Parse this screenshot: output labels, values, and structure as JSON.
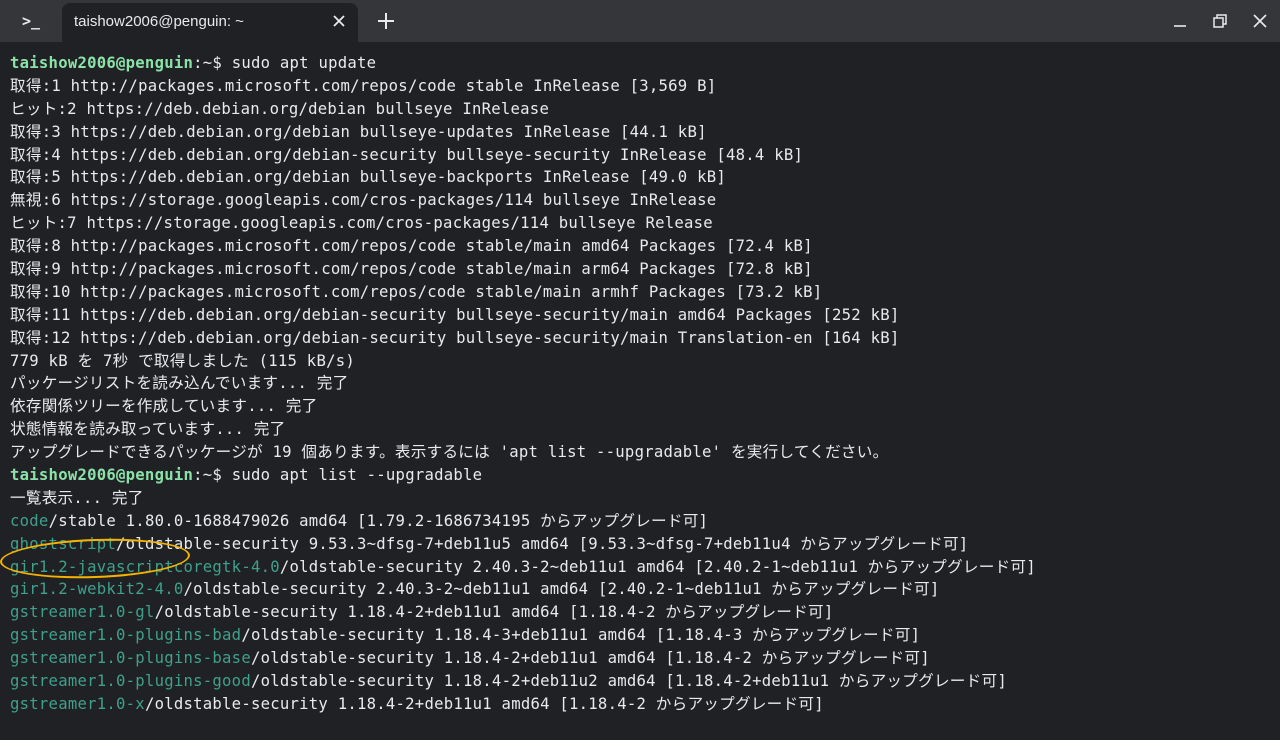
{
  "window": {
    "app_icon_label": ">_",
    "tab_title": "taishow2006@penguin: ~",
    "icons": {
      "app": "terminal-prompt-icon",
      "tab_close": "close-icon",
      "new_tab": "plus-icon",
      "minimize": "minimize-icon",
      "maximize": "maximize-icon",
      "close": "close-icon"
    }
  },
  "colors": {
    "background": "#202124",
    "titlebar": "#35363a",
    "prompt": "#8ae2a8",
    "package_name": "#3fa08b",
    "annotation_circle": "#f5b300"
  },
  "terminal": {
    "prompt_user": "taishow2006@penguin",
    "prompt_path": ":~$ ",
    "cmd1": "sudo apt update",
    "cmd2": "sudo apt list --upgradable",
    "update_output": [
      "取得:1 http://packages.microsoft.com/repos/code stable InRelease [3,569 B]",
      "ヒット:2 https://deb.debian.org/debian bullseye InRelease",
      "取得:3 https://deb.debian.org/debian bullseye-updates InRelease [44.1 kB]",
      "取得:4 https://deb.debian.org/debian-security bullseye-security InRelease [48.4 kB]",
      "取得:5 https://deb.debian.org/debian bullseye-backports InRelease [49.0 kB]",
      "無視:6 https://storage.googleapis.com/cros-packages/114 bullseye InRelease",
      "ヒット:7 https://storage.googleapis.com/cros-packages/114 bullseye Release",
      "取得:8 http://packages.microsoft.com/repos/code stable/main amd64 Packages [72.4 kB]",
      "取得:9 http://packages.microsoft.com/repos/code stable/main arm64 Packages [72.8 kB]",
      "取得:10 http://packages.microsoft.com/repos/code stable/main armhf Packages [73.2 kB]",
      "取得:11 https://deb.debian.org/debian-security bullseye-security/main amd64 Packages [252 kB]",
      "取得:12 https://deb.debian.org/debian-security bullseye-security/main Translation-en [164 kB]",
      "779 kB を 7秒 で取得しました (115 kB/s)",
      "パッケージリストを読み込んでいます... 完了",
      "依存関係ツリーを作成しています... 完了",
      "状態情報を読み取っています... 完了",
      "アップグレードできるパッケージが 19 個あります。表示するには 'apt list --upgradable' を実行してください。"
    ],
    "list_header": "一覧表示... 完了",
    "upgradable": [
      {
        "name": "code",
        "rest": "/stable 1.80.0-1688479026 amd64 [1.79.2-1686734195 からアップグレード可]"
      },
      {
        "name": "ghostscript",
        "rest": "/oldstable-security 9.53.3~dfsg-7+deb11u5 amd64 [9.53.3~dfsg-7+deb11u4 からアップグレード可]"
      },
      {
        "name": "gir1.2-javascriptcoregtk-4.0",
        "rest": "/oldstable-security 2.40.3-2~deb11u1 amd64 [2.40.2-1~deb11u1 からアップグレード可]"
      },
      {
        "name": "gir1.2-webkit2-4.0",
        "rest": "/oldstable-security 2.40.3-2~deb11u1 amd64 [2.40.2-1~deb11u1 からアップグレード可]"
      },
      {
        "name": "gstreamer1.0-gl",
        "rest": "/oldstable-security 1.18.4-2+deb11u1 amd64 [1.18.4-2 からアップグレード可]"
      },
      {
        "name": "gstreamer1.0-plugins-bad",
        "rest": "/oldstable-security 1.18.4-3+deb11u1 amd64 [1.18.4-3 からアップグレード可]"
      },
      {
        "name": "gstreamer1.0-plugins-base",
        "rest": "/oldstable-security 1.18.4-2+deb11u1 amd64 [1.18.4-2 からアップグレード可]"
      },
      {
        "name": "gstreamer1.0-plugins-good",
        "rest": "/oldstable-security 1.18.4-2+deb11u2 amd64 [1.18.4-2+deb11u1 からアップグレード可]"
      },
      {
        "name": "gstreamer1.0-x",
        "rest": "/oldstable-security 1.18.4-2+deb11u1 amd64 [1.18.4-2 からアップグレード可]"
      }
    ]
  }
}
